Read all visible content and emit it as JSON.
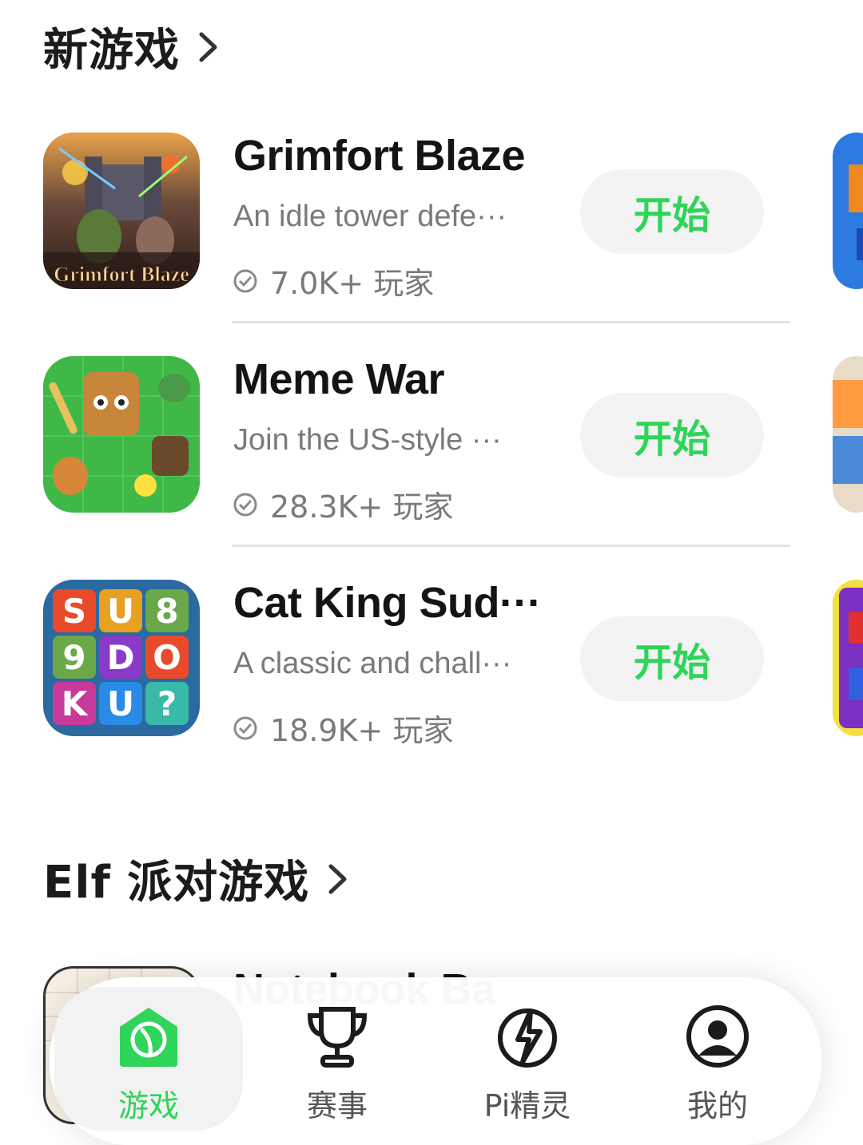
{
  "sections": {
    "new_games": {
      "title": "新游戏"
    },
    "elf_party": {
      "title": "Elf 派对游戏"
    }
  },
  "games": [
    {
      "name": "Grimfort Blaze",
      "desc": "An idle tower defe···",
      "players": "7.0K+ 玩家",
      "button": "开始",
      "icon_text": "Grimfort Blaze"
    },
    {
      "name": "Meme War",
      "desc": "Join the US-style ···",
      "players": "28.3K+ 玩家",
      "button": "开始"
    },
    {
      "name": "Cat King Sud···",
      "desc": "A classic and chall···",
      "players": "18.9K+ 玩家",
      "button": "开始",
      "icon_tiles": [
        "S",
        "U",
        "8",
        "9",
        "D",
        "O",
        "K",
        "U",
        "?"
      ]
    }
  ],
  "partial_game": {
    "name": "Notebook Ba"
  },
  "nav": {
    "items": [
      {
        "label": "游戏",
        "icon": "home-leaf-icon",
        "active": true
      },
      {
        "label": "赛事",
        "icon": "trophy-icon",
        "active": false
      },
      {
        "label": "Pi精灵",
        "icon": "lightning-icon",
        "active": false
      },
      {
        "label": "我的",
        "icon": "profile-icon",
        "active": false
      }
    ]
  },
  "colors": {
    "accent": "#2fd45a",
    "button_bg": "#f2f3f2",
    "text_secondary": "#7a7a7a"
  }
}
